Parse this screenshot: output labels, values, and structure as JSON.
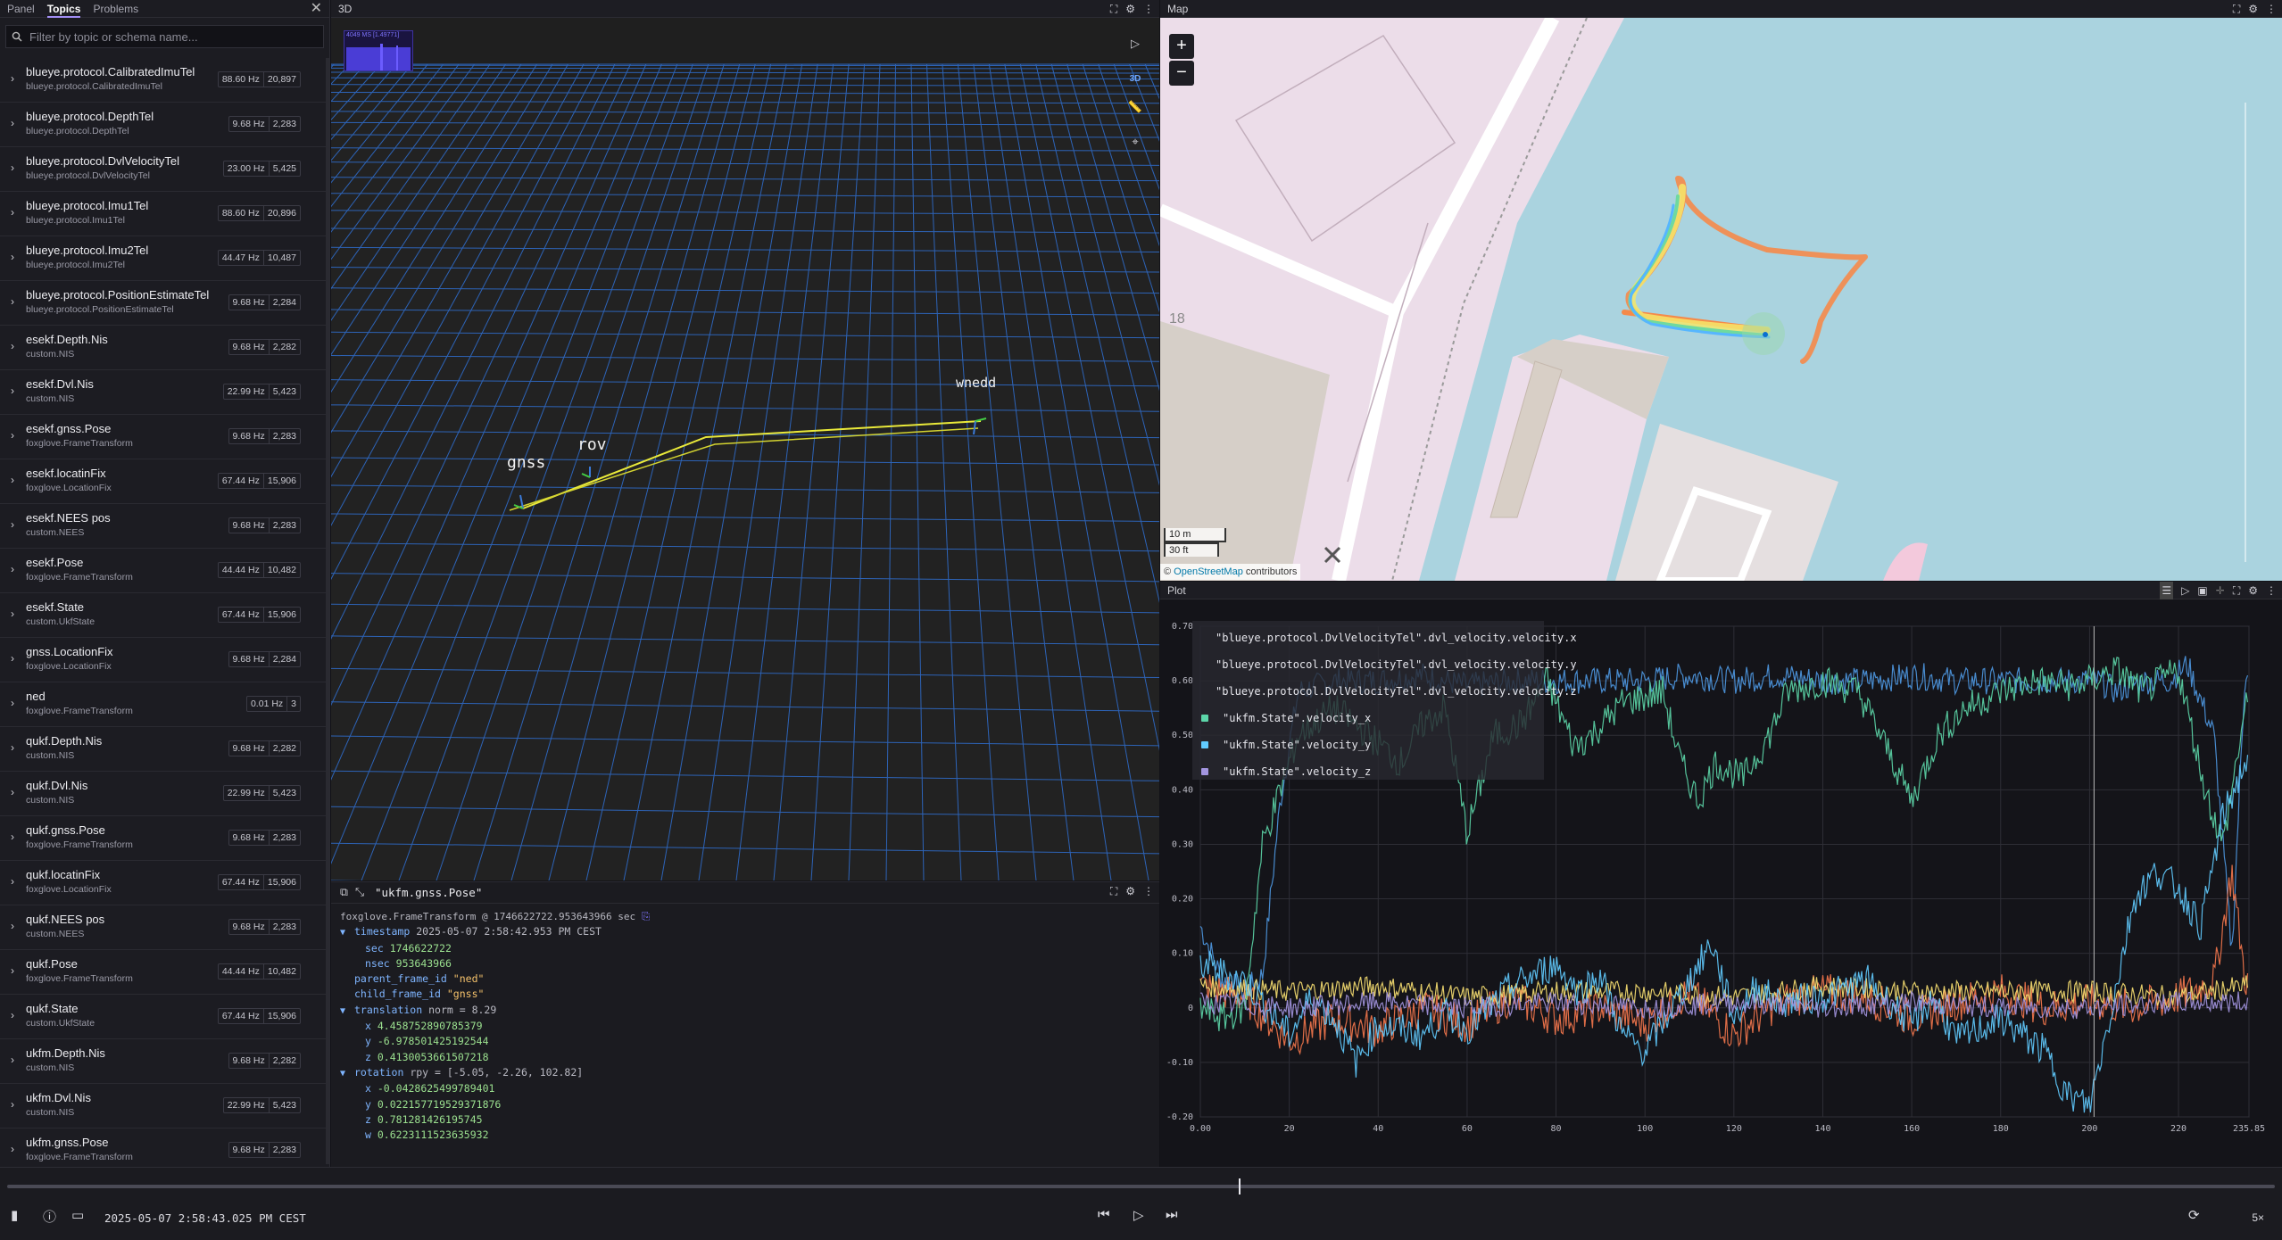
{
  "sidebar": {
    "tabs": [
      "Panel",
      "Topics",
      "Problems"
    ],
    "active_tab": "Topics",
    "filter_placeholder": "Filter by topic or schema name...",
    "topics": [
      {
        "name": "blueye.protocol.CalibratedImuTel",
        "schema": "blueye.protocol.CalibratedImuTel",
        "hz": "88.60 Hz",
        "count": "20,897"
      },
      {
        "name": "blueye.protocol.DepthTel",
        "schema": "blueye.protocol.DepthTel",
        "hz": "9.68 Hz",
        "count": "2,283"
      },
      {
        "name": "blueye.protocol.DvlVelocityTel",
        "schema": "blueye.protocol.DvlVelocityTel",
        "hz": "23.00 Hz",
        "count": "5,425"
      },
      {
        "name": "blueye.protocol.Imu1Tel",
        "schema": "blueye.protocol.Imu1Tel",
        "hz": "88.60 Hz",
        "count": "20,896"
      },
      {
        "name": "blueye.protocol.Imu2Tel",
        "schema": "blueye.protocol.Imu2Tel",
        "hz": "44.47 Hz",
        "count": "10,487"
      },
      {
        "name": "blueye.protocol.PositionEstimateTel",
        "schema": "blueye.protocol.PositionEstimateTel",
        "hz": "9.68 Hz",
        "count": "2,284"
      },
      {
        "name": "esekf.Depth.Nis",
        "schema": "custom.NIS",
        "hz": "9.68 Hz",
        "count": "2,282"
      },
      {
        "name": "esekf.Dvl.Nis",
        "schema": "custom.NIS",
        "hz": "22.99 Hz",
        "count": "5,423"
      },
      {
        "name": "esekf.gnss.Pose",
        "schema": "foxglove.FrameTransform",
        "hz": "9.68 Hz",
        "count": "2,283"
      },
      {
        "name": "esekf.locatinFix",
        "schema": "foxglove.LocationFix",
        "hz": "67.44 Hz",
        "count": "15,906"
      },
      {
        "name": "esekf.NEES pos",
        "schema": "custom.NEES",
        "hz": "9.68 Hz",
        "count": "2,283"
      },
      {
        "name": "esekf.Pose",
        "schema": "foxglove.FrameTransform",
        "hz": "44.44 Hz",
        "count": "10,482"
      },
      {
        "name": "esekf.State",
        "schema": "custom.UkfState",
        "hz": "67.44 Hz",
        "count": "15,906"
      },
      {
        "name": "gnss.LocationFix",
        "schema": "foxglove.LocationFix",
        "hz": "9.68 Hz",
        "count": "2,284"
      },
      {
        "name": "ned",
        "schema": "foxglove.FrameTransform",
        "hz": "0.01 Hz",
        "count": "3"
      },
      {
        "name": "qukf.Depth.Nis",
        "schema": "custom.NIS",
        "hz": "9.68 Hz",
        "count": "2,282"
      },
      {
        "name": "qukf.Dvl.Nis",
        "schema": "custom.NIS",
        "hz": "22.99 Hz",
        "count": "5,423"
      },
      {
        "name": "qukf.gnss.Pose",
        "schema": "foxglove.FrameTransform",
        "hz": "9.68 Hz",
        "count": "2,283"
      },
      {
        "name": "qukf.locatinFix",
        "schema": "foxglove.LocationFix",
        "hz": "67.44 Hz",
        "count": "15,906"
      },
      {
        "name": "qukf.NEES pos",
        "schema": "custom.NEES",
        "hz": "9.68 Hz",
        "count": "2,283"
      },
      {
        "name": "qukf.Pose",
        "schema": "foxglove.FrameTransform",
        "hz": "44.44 Hz",
        "count": "10,482"
      },
      {
        "name": "qukf.State",
        "schema": "custom.UkfState",
        "hz": "67.44 Hz",
        "count": "15,906"
      },
      {
        "name": "ukfm.Depth.Nis",
        "schema": "custom.NIS",
        "hz": "9.68 Hz",
        "count": "2,282"
      },
      {
        "name": "ukfm.Dvl.Nis",
        "schema": "custom.NIS",
        "hz": "22.99 Hz",
        "count": "5,423"
      },
      {
        "name": "ukfm.gnss.Pose",
        "schema": "foxglove.FrameTransform",
        "hz": "9.68 Hz",
        "count": "2,283"
      }
    ]
  },
  "panel_3d": {
    "title": "3D",
    "perf_label": "4049 MS [1.49771]",
    "view_mode": "3D",
    "frame_labels": [
      "gnss",
      "rov",
      "wnedd"
    ]
  },
  "raw_message": {
    "topic": "\"ukfm.gnss.Pose\"",
    "meta": "foxglove.FrameTransform @ 1746622722.953643966 sec",
    "timestamp_label": "timestamp",
    "timestamp_value": "2025-05-07 2:58:42.953 PM CEST",
    "sec_key": "sec",
    "sec_val": "1746622722",
    "nsec_key": "nsec",
    "nsec_val": "953643966",
    "parent_key": "parent_frame_id",
    "parent_val": "\"ned\"",
    "child_key": "child_frame_id",
    "child_val": "\"gnss\"",
    "translation_key": "translation",
    "translation_note": "norm = 8.29",
    "tx_key": "x",
    "tx": "4.458752890785379",
    "ty_key": "y",
    "ty": "-6.978501425192544",
    "tz_key": "z",
    "tz": "0.4130053661507218",
    "rotation_key": "rotation",
    "rotation_note": "rpy = [-5.05, -2.26, 102.82]",
    "rx_key": "x",
    "rx": "-0.0428625499789401",
    "ry_key": "y",
    "ry": "0.022157719529371876",
    "rz_key": "z",
    "rz": "0.781281426195745",
    "rw_key": "w",
    "rw": "0.6223111523635932"
  },
  "map": {
    "title": "Map",
    "zoom_in": "+",
    "zoom_out": "−",
    "road_label": "18",
    "scale_metric": "10 m",
    "scale_imperial": "30 ft",
    "attribution_prefix": "©",
    "attribution_link": "OpenStreetMap",
    "attribution_suffix": "contributors"
  },
  "plot": {
    "title": "Plot",
    "legend": [
      {
        "label": "\"blueye.protocol.DvlVelocityTel\".dvl_velocity.velocity.x",
        "color": "#4e98e2"
      },
      {
        "label": "\"blueye.protocol.DvlVelocityTel\".dvl_velocity.velocity.y",
        "color": "#f5774d"
      },
      {
        "label": "\"blueye.protocol.DvlVelocityTel\".dvl_velocity.velocity.z",
        "color": "#f7df71"
      },
      {
        "label": "\"ukfm.State\".velocity_x",
        "color": "#5cd6a9"
      },
      {
        "label": "\"ukfm.State\".velocity_y",
        "color": "#61cbff"
      },
      {
        "label": "\"ukfm.State\".velocity_z",
        "color": "#a395e0"
      }
    ],
    "y_ticks": [
      "0.70",
      "0.60",
      "0.50",
      "0.40",
      "0.30",
      "0.20",
      "0.10",
      "0",
      "-0.10",
      "-0.20"
    ],
    "x_ticks": [
      "0.00",
      "20",
      "40",
      "60",
      "80",
      "100",
      "120",
      "140",
      "160",
      "180",
      "200",
      "220",
      "235.85"
    ]
  },
  "chart_data": {
    "type": "line",
    "xlim": [
      0,
      235.85
    ],
    "ylim": [
      -0.2,
      0.7
    ],
    "cursor_x": 201,
    "series": [
      {
        "name": "\"blueye.protocol.DvlVelocityTel\".dvl_velocity.velocity.x",
        "x": [
          0,
          5,
          10,
          14,
          18,
          22,
          30,
          40,
          50,
          60,
          70,
          80,
          90,
          100,
          110,
          120,
          130,
          140,
          150,
          160,
          170,
          180,
          190,
          198,
          202,
          206,
          212,
          218,
          222,
          228,
          232,
          235
        ],
        "y": [
          0.15,
          0.05,
          0.03,
          0.06,
          0.38,
          0.58,
          0.6,
          0.6,
          0.61,
          0.59,
          0.6,
          0.6,
          0.6,
          0.6,
          0.61,
          0.6,
          0.61,
          0.6,
          0.6,
          0.61,
          0.6,
          0.6,
          0.6,
          0.6,
          0.6,
          0.58,
          0.6,
          0.6,
          0.63,
          0.5,
          0.1,
          0.62
        ]
      },
      {
        "name": "\"blueye.protocol.DvlVelocityTel\".dvl_velocity.velocity.y",
        "x": [
          0,
          10,
          20,
          30,
          40,
          50,
          60,
          70,
          80,
          90,
          100,
          110,
          120,
          130,
          140,
          150,
          160,
          170,
          180,
          190,
          200,
          210,
          220,
          228,
          232,
          235
        ],
        "y": [
          0.04,
          0.02,
          -0.06,
          -0.02,
          -0.04,
          0.0,
          -0.03,
          0.02,
          -0.02,
          0.0,
          -0.03,
          0.03,
          -0.05,
          0.01,
          0.03,
          0.02,
          -0.02,
          0.01,
          0.03,
          0.0,
          0.01,
          0.0,
          0.02,
          0.05,
          0.25,
          0.05
        ]
      },
      {
        "name": "\"blueye.protocol.DvlVelocityTel\".dvl_velocity.velocity.z",
        "x": [
          0,
          20,
          40,
          60,
          80,
          100,
          120,
          140,
          160,
          180,
          200,
          220,
          235
        ],
        "y": [
          0.04,
          0.03,
          0.04,
          0.02,
          0.03,
          0.03,
          0.02,
          0.04,
          0.03,
          0.03,
          0.03,
          0.02,
          0.04
        ]
      },
      {
        "name": "\"ukfm.State\".velocity_x",
        "x": [
          0,
          5,
          10,
          14,
          18,
          22,
          30,
          38,
          45,
          50,
          55,
          60,
          66,
          72,
          78,
          84,
          88,
          95,
          100,
          104,
          108,
          112,
          116,
          122,
          128,
          132,
          140,
          148,
          156,
          160,
          166,
          172,
          180,
          188,
          196,
          200,
          206,
          212,
          216,
          220,
          226,
          230,
          235
        ],
        "y": [
          0.0,
          -0.02,
          0.0,
          0.3,
          0.4,
          0.5,
          0.55,
          0.5,
          0.45,
          0.52,
          0.55,
          0.32,
          0.5,
          0.52,
          0.6,
          0.48,
          0.5,
          0.56,
          0.57,
          0.58,
          0.45,
          0.38,
          0.45,
          0.42,
          0.5,
          0.58,
          0.6,
          0.58,
          0.45,
          0.38,
          0.5,
          0.55,
          0.58,
          0.6,
          0.59,
          0.6,
          0.62,
          0.58,
          0.6,
          0.62,
          0.4,
          0.3,
          0.55
        ]
      },
      {
        "name": "\"ukfm.State\".velocity_y",
        "x": [
          0,
          10,
          20,
          25,
          30,
          35,
          40,
          50,
          55,
          60,
          70,
          80,
          85,
          90,
          95,
          100,
          110,
          115,
          120,
          125,
          130,
          140,
          150,
          160,
          165,
          170,
          180,
          190,
          195,
          200,
          205,
          210,
          215,
          220,
          225,
          230,
          235
        ],
        "y": [
          0.08,
          0.05,
          -0.05,
          0.02,
          -0.02,
          -0.1,
          -0.03,
          -0.05,
          -0.01,
          -0.04,
          0.04,
          0.08,
          0.03,
          0.06,
          -0.05,
          -0.08,
          0.05,
          0.12,
          -0.02,
          0.04,
          0.01,
          0.02,
          0.05,
          -0.03,
          0.02,
          -0.06,
          -0.02,
          -0.08,
          -0.16,
          -0.18,
          0.0,
          0.2,
          0.25,
          0.22,
          0.15,
          0.35,
          0.45
        ]
      },
      {
        "name": "\"ukfm.State\".velocity_z",
        "x": [
          0,
          20,
          40,
          60,
          80,
          100,
          120,
          140,
          160,
          180,
          200,
          220,
          235
        ],
        "y": [
          0.01,
          0.0,
          0.01,
          0.0,
          0.01,
          0.0,
          0.01,
          0.0,
          0.01,
          0.0,
          0.0,
          0.01,
          0.01
        ]
      }
    ]
  },
  "playback": {
    "time": "2025-05-07 2:58:43.025 PM CEST",
    "speed": "5×",
    "progress": 0.543
  }
}
